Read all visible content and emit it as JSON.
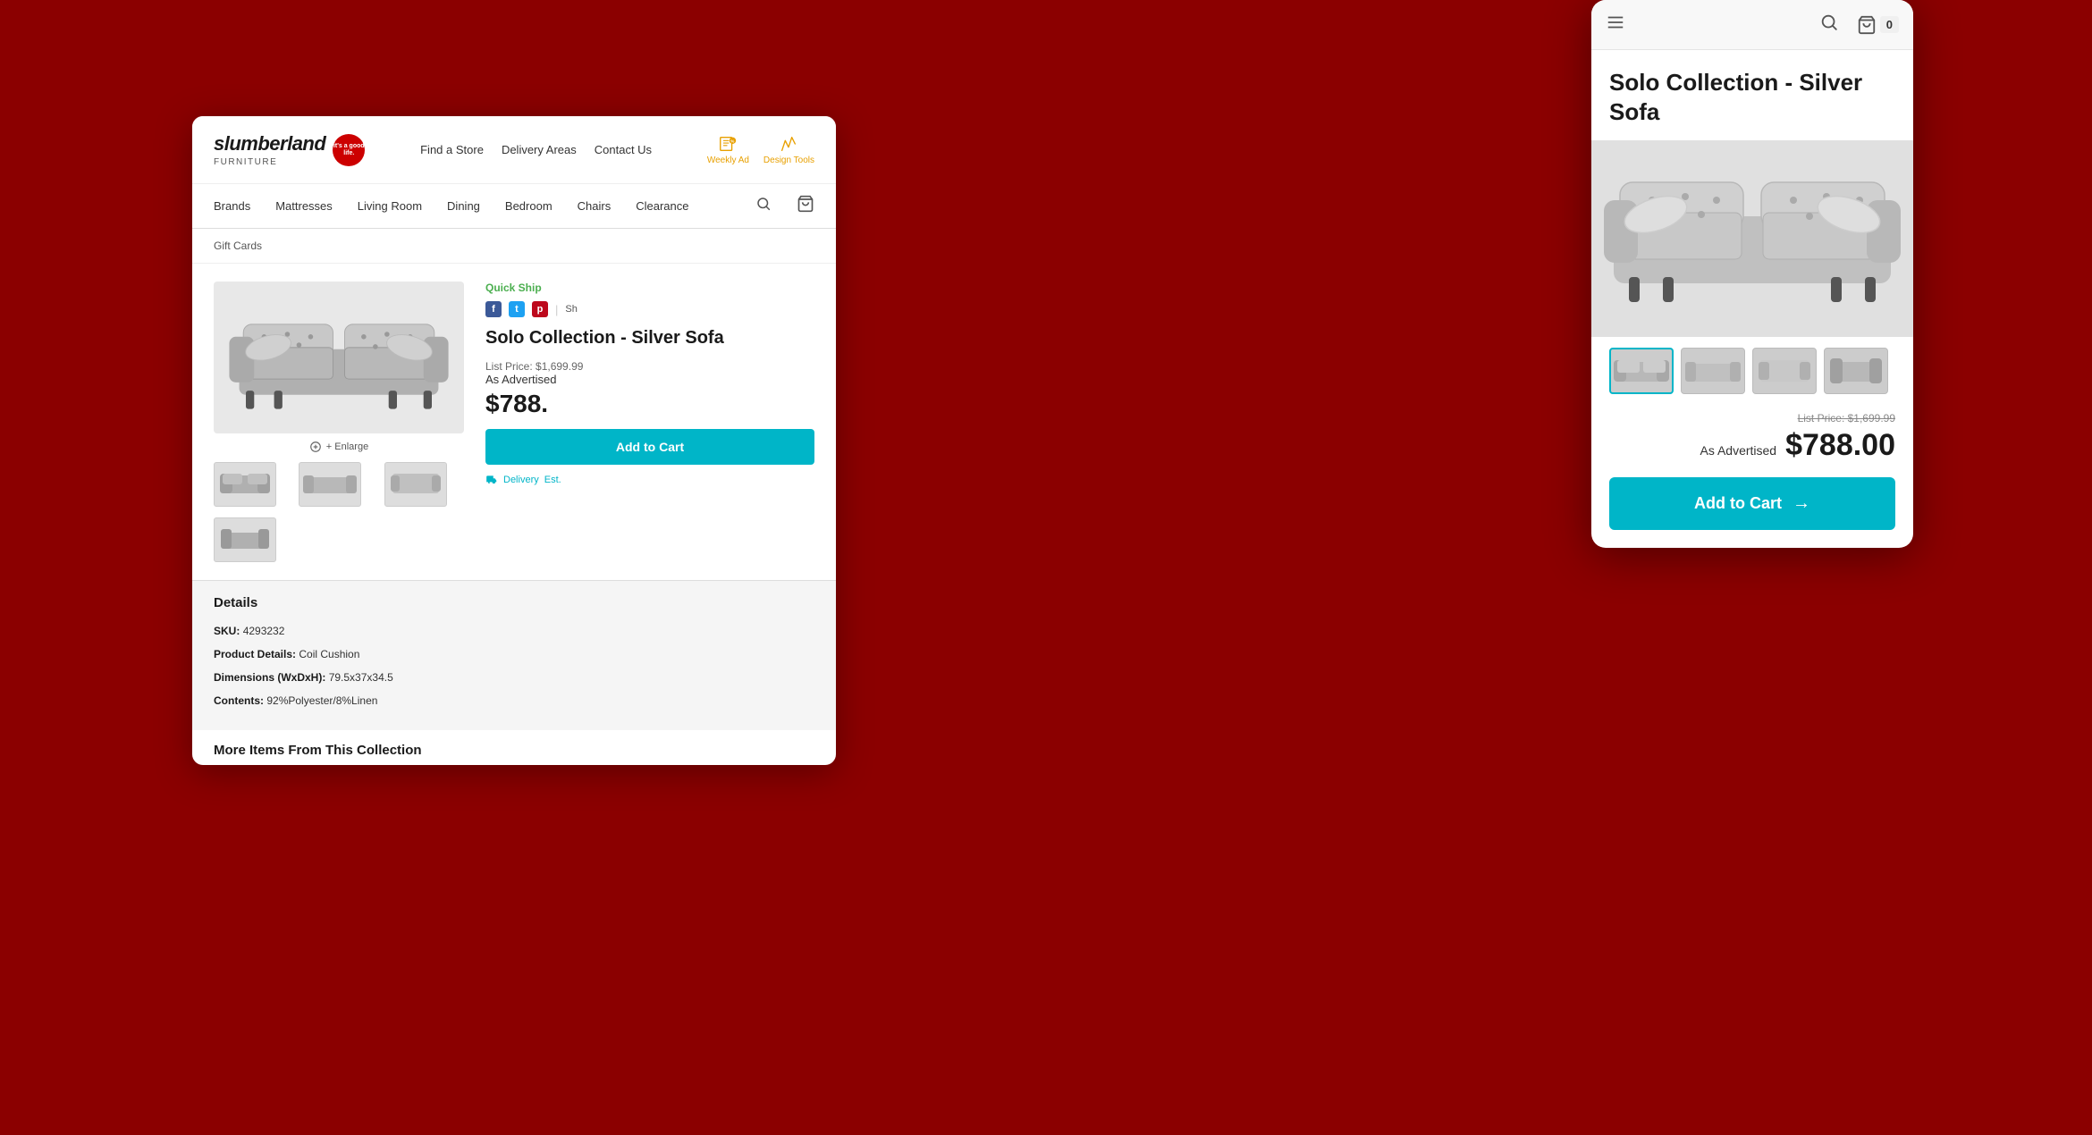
{
  "background_color": "#8b0000",
  "desktop": {
    "logo": {
      "brand_name": "slumberland",
      "subtitle": "FURNITURE",
      "badge_text": "it's a good life.",
      "nav_links": [
        "Find a Store",
        "Delivery Areas",
        "Contact Us"
      ],
      "nav_icon_weekly": "Weekly Ad",
      "nav_icon_design": "Design Tools"
    },
    "menu": {
      "items": [
        "Brands",
        "Mattresses",
        "Living Room",
        "Dining",
        "Bedroom",
        "Chairs",
        "Clearance"
      ]
    },
    "gift_cards": "Gift Cards",
    "product": {
      "quick_ship": "Quick Ship",
      "title": "Solo Collection - Silver Sofa",
      "list_price_label": "List Price:",
      "list_price": "$1,699.99",
      "as_advertised_label": "As Advertised",
      "sale_price": "$788.",
      "add_to_cart": "Add to Cart",
      "delivery_line1": "Delivery",
      "delivery_line2": "Est."
    },
    "details": {
      "section_title": "Details",
      "sku_label": "SKU:",
      "sku_value": "4293232",
      "product_details_label": "Product Details:",
      "product_details_value": "Coil Cushion",
      "dimensions_label": "Dimensions (WxDxH):",
      "dimensions_value": "79.5x37x34.5",
      "contents_label": "Contents:",
      "contents_value": "92%Polyester/8%Linen"
    },
    "more_items": "More Items From This Collection",
    "enlarge": "+ Enlarge"
  },
  "mobile": {
    "header": {
      "menu_icon": "menu",
      "search_icon": "search",
      "cart_icon": "cart",
      "cart_count": "0"
    },
    "product_title": "Solo Collection - Silver Sofa",
    "list_price_label": "List Price: $1,699.99",
    "as_advertised_label": "As Advertised",
    "sale_price": "$788.00",
    "add_to_cart": "Add to Cart"
  },
  "colors": {
    "teal": "#00b5c8",
    "dark_red": "#8b0000",
    "facebook": "#3b5998",
    "twitter": "#1da1f2",
    "pinterest": "#bd081c",
    "quick_ship_green": "#4caf50",
    "weekly_ad_orange": "#e8a000"
  }
}
